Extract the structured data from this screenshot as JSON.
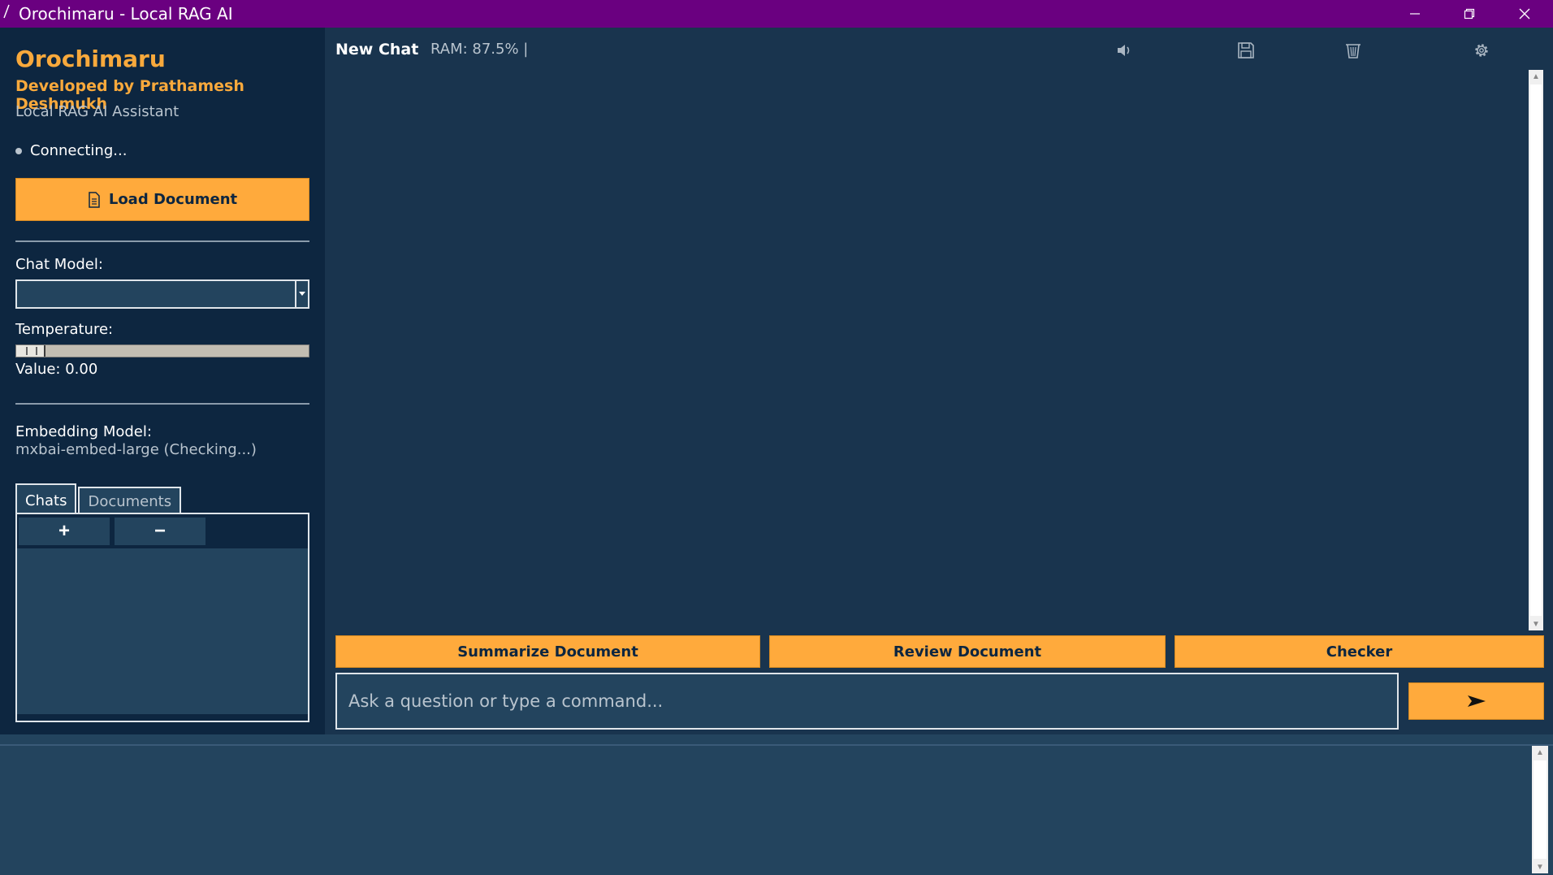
{
  "window": {
    "title": "Orochimaru - Local RAG AI",
    "title_bar_color": "#6a0080"
  },
  "sidebar": {
    "app_name": "Orochimaru",
    "developer": "Developed by Prathamesh Deshmukh",
    "subtitle": "Local RAG AI Assistant",
    "status": "Connecting...",
    "load_button": "Load Document",
    "chat_model_label": "Chat Model:",
    "chat_model_value": "",
    "temperature_label": "Temperature:",
    "temperature_value_text": "Value: 0.00",
    "temperature_value": 0.0,
    "embedding_label": "Embedding Model:",
    "embedding_value": "mxbai-embed-large (Checking...)",
    "tabs": [
      {
        "label": "Chats",
        "active": true
      },
      {
        "label": "Documents",
        "active": false
      }
    ],
    "add_button": "+",
    "remove_button": "−"
  },
  "main": {
    "chat_title": "New Chat",
    "ram": "RAM: 87.5%  |",
    "toolbar_icons": [
      "speaker-icon",
      "save-icon",
      "trash-icon",
      "settings-icon"
    ],
    "actions": {
      "summarize": "Summarize Document",
      "review": "Review Document",
      "checker": "Checker"
    },
    "input_placeholder": "Ask a question or type a command...",
    "send_glyph": "➤"
  },
  "colors": {
    "accent": "#ffaa3c",
    "sidebar_bg": "#0d2640",
    "main_bg": "#19344e",
    "panel_bg": "#23445e"
  }
}
